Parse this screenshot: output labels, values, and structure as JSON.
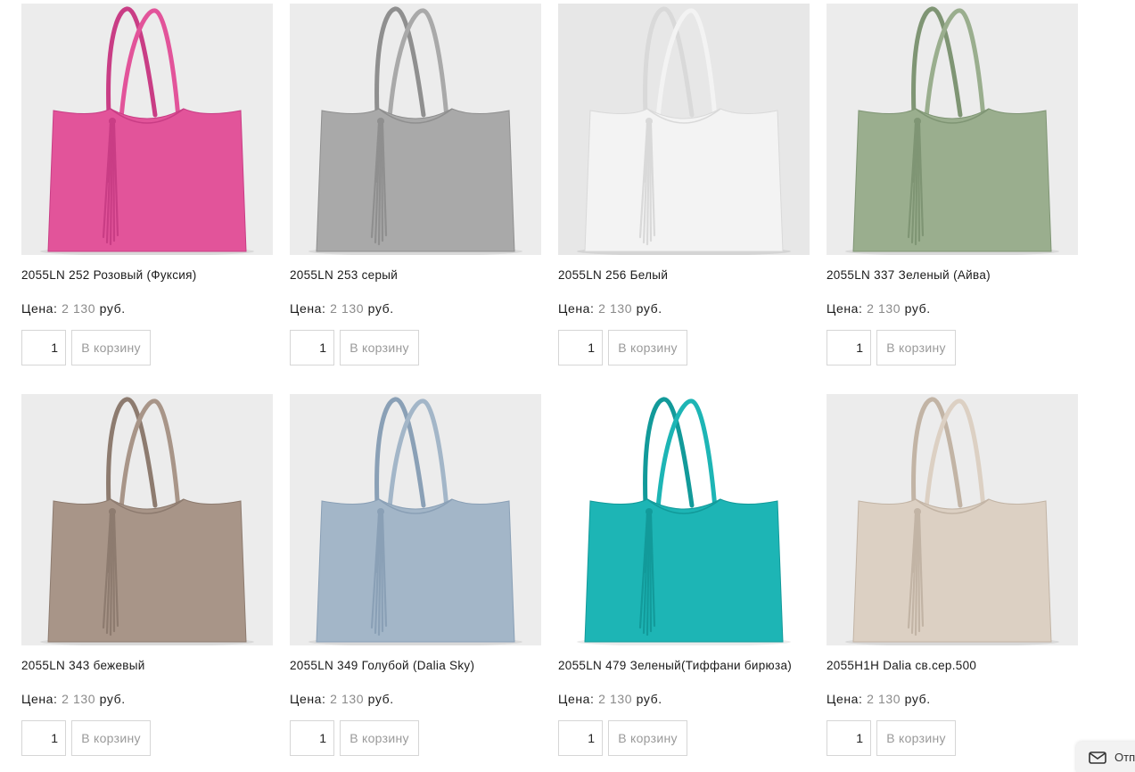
{
  "products": [
    {
      "title": "2055LN 252 Розовый (Фуксия)",
      "price_label": "Цена:",
      "price": "2 130",
      "currency": "руб.",
      "qty": "1",
      "cart_label": "В корзину",
      "color": "#e2549a",
      "accent": "#c93d85",
      "bg": "#ececec"
    },
    {
      "title": "2055LN 253 серый",
      "price_label": "Цена:",
      "price": "2 130",
      "currency": "руб.",
      "qty": "1",
      "cart_label": "В корзину",
      "color": "#a9a9a9",
      "accent": "#8f8f8f",
      "bg": "#ececec"
    },
    {
      "title": "2055LN 256 Белый",
      "price_label": "Цена:",
      "price": "2 130",
      "currency": "руб.",
      "qty": "1",
      "cart_label": "В корзину",
      "color": "#f3f3f3",
      "accent": "#d9d9d9",
      "bg": "#e7e7e7"
    },
    {
      "title": "2055LN 337 Зеленый (Айва)",
      "price_label": "Цена:",
      "price": "2 130",
      "currency": "руб.",
      "qty": "1",
      "cart_label": "В корзину",
      "color": "#9aae8e",
      "accent": "#7f9574",
      "bg": "#ececec"
    },
    {
      "title": "2055LN 343 бежевый",
      "price_label": "Цена:",
      "price": "2 130",
      "currency": "руб.",
      "qty": "1",
      "cart_label": "В корзину",
      "color": "#a89588",
      "accent": "#8d7b6f",
      "bg": "#ececec"
    },
    {
      "title": "2055LN 349 Голубой (Dalia Sky)",
      "price_label": "Цена:",
      "price": "2 130",
      "currency": "руб.",
      "qty": "1",
      "cart_label": "В корзину",
      "color": "#a3b6c8",
      "accent": "#8aa0b6",
      "bg": "#ececec"
    },
    {
      "title": "2055LN 479 Зеленый(Тиффани бирюза)",
      "price_label": "Цена:",
      "price": "2 130",
      "currency": "руб.",
      "qty": "1",
      "cart_label": "В корзину",
      "color": "#1db5b5",
      "accent": "#129a9a",
      "bg": "#ffffff"
    },
    {
      "title": "2055H1H Dalia св.сер.500",
      "price_label": "Цена:",
      "price": "2 130",
      "currency": "руб.",
      "qty": "1",
      "cart_label": "В корзину",
      "color": "#dcd0c3",
      "accent": "#c2b4a5",
      "bg": "#ececec"
    }
  ],
  "feedback": {
    "label": "Отп",
    "icon": "envelope-icon"
  }
}
